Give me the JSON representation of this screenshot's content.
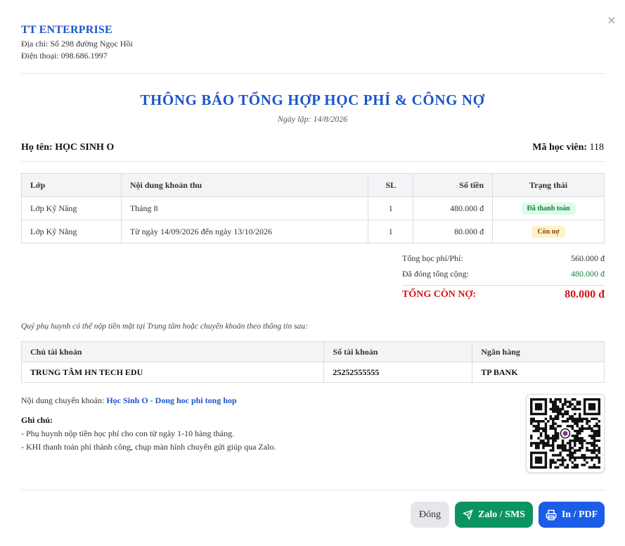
{
  "company": {
    "name": "TT ENTERPRISE",
    "address": "Địa chỉ: Số 298 đường Ngọc Hồi",
    "phone": "Điện thoại: 098.686.1997"
  },
  "document": {
    "title": "THÔNG BÁO TỔNG HỢP HỌC PHÍ & CÔNG NỢ",
    "date": "Ngày lập: 14/8/2026"
  },
  "student": {
    "name_label": "Họ tên: HỌC SINH O",
    "id_label": "Mã học viên:",
    "id_value": "118"
  },
  "fees": {
    "headers": [
      "Lớp",
      "Nội dung khoản thu",
      "SL",
      "Số tiền",
      "Trạng thái"
    ],
    "rows": [
      {
        "class": "Lớp Kỹ Năng",
        "content": "Tháng 8",
        "qty": "1",
        "amount": "480.000 đ",
        "status": "Đã thanh toán",
        "status_color": "#15803d"
      },
      {
        "class": "Lớp Kỹ Năng",
        "content": "Từ ngày 14/09/2026 đến ngày 13/10/2026",
        "qty": "1",
        "amount": "80.000 đ",
        "status": "Còn nợ",
        "status_color": "#92400e"
      }
    ]
  },
  "summary": {
    "total_fee_label": "Tổng học phí/Phí:",
    "total_fee_value": "560.000 đ",
    "paid_label": "Đã đóng tổng cộng:",
    "paid_value": "480.000 đ",
    "debt_label": "TỔNG CÒN NỢ:",
    "debt_value": "80.000 đ"
  },
  "payment": {
    "intro": "Quý phụ huynh có thể nộp tiền mặt tại Trung tâm hoặc chuyển khoản theo thông tin sau:",
    "headers": [
      "Chủ tài khoản",
      "Số tài khoản",
      "Ngân hàng"
    ],
    "account_holder": "TRUNG TÂM HN TECH EDU",
    "account_number": "25252555555",
    "bank": "TP BANK",
    "transfer_label": "Nội dung chuyển khoản:",
    "transfer_content": "Học Sinh O - Dong hoc phi tong hop"
  },
  "notes": {
    "title": "Ghi chú:",
    "items": [
      "- Phụ huynh nộp tiền học phí cho con từ ngày 1-10 hàng tháng.",
      "- KHI thanh toán phí thành công, chụp màn hình chuyển gửi giúp qua Zalo."
    ]
  },
  "buttons": {
    "close": "Đóng",
    "zalo": "Zalo / SMS",
    "print": "In / PDF"
  },
  "colors": {
    "brand_blue": "#1d55c9",
    "debt_red": "#d4141c",
    "paid_green": "#15803d",
    "zalo_green": "#0b9462",
    "print_blue": "#1b5de6"
  },
  "icons": {
    "close": "close-icon",
    "zalo": "send-icon",
    "print": "printer-icon",
    "qr": "qr-code"
  }
}
